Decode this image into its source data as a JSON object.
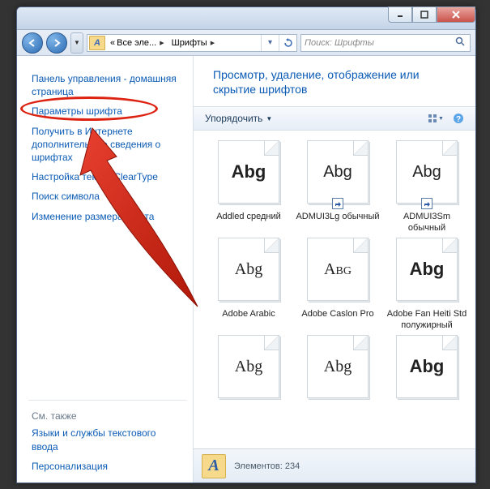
{
  "breadcrumb": {
    "root_prefix": "«",
    "root": "Все эле...",
    "current": "Шрифты"
  },
  "search": {
    "placeholder": "Поиск: Шрифты"
  },
  "sidebar": {
    "links": [
      "Панель управления - домашняя страница",
      "Параметры шрифта",
      "Получить в Интернете дополнительные сведения о шрифтах",
      "Настройка текста ClearType",
      "Поиск символа",
      "Изменение размера текста"
    ],
    "see_also_label": "См. также",
    "see_also": [
      "Языки и службы текстового ввода",
      "Персонализация"
    ]
  },
  "heading": "Просмотр, удаление, отображение или скрытие шрифтов",
  "toolbar": {
    "organize": "Упорядочить"
  },
  "fonts": [
    {
      "sample": "Abg",
      "label": "Addled средний",
      "style": "bold",
      "multi": false,
      "shortcut": false
    },
    {
      "sample": "Abg",
      "label": "ADMUI3Lg обычный",
      "style": "thin",
      "multi": false,
      "shortcut": true
    },
    {
      "sample": "Abg",
      "label": "ADMUI3Sm обычный",
      "style": "thin",
      "multi": false,
      "shortcut": true
    },
    {
      "sample": "Abg",
      "label": "Adobe Arabic",
      "style": "serif",
      "multi": true,
      "shortcut": false
    },
    {
      "sample": "Abg",
      "label": "Adobe Caslon Pro",
      "style": "sc",
      "multi": true,
      "shortcut": false
    },
    {
      "sample": "Abg",
      "label": "Adobe Fan Heiti Std полужирный",
      "style": "bold",
      "multi": false,
      "shortcut": false
    },
    {
      "sample": "Abg",
      "label": "",
      "style": "serif",
      "multi": true,
      "shortcut": false
    },
    {
      "sample": "Abg",
      "label": "",
      "style": "serif",
      "multi": true,
      "shortcut": false
    },
    {
      "sample": "Abg",
      "label": "",
      "style": "bold",
      "multi": true,
      "shortcut": false
    }
  ],
  "status": {
    "label": "Элементов:",
    "count": "234"
  }
}
